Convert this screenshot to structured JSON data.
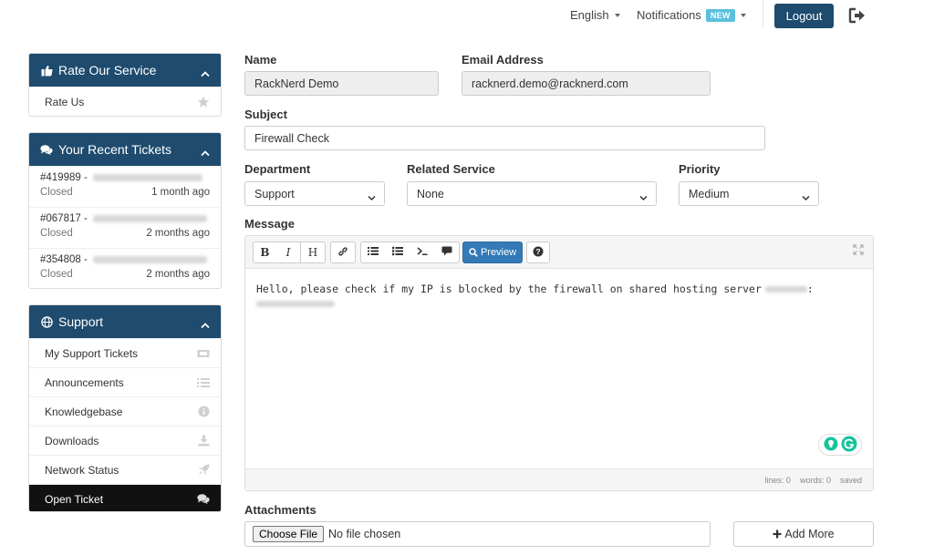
{
  "topbar": {
    "language": "English",
    "notifications": "Notifications",
    "new_badge": "NEW",
    "logout": "Logout"
  },
  "sidebar": {
    "rate": {
      "title": "Rate Our Service",
      "items": [
        {
          "label": "Rate Us",
          "icon": "star-icon"
        }
      ]
    },
    "tickets": {
      "title": "Your Recent Tickets",
      "items": [
        {
          "id": "#419989 - ",
          "status": "Closed",
          "time": "1 month ago"
        },
        {
          "id": "#067817 - ",
          "status": "Closed",
          "time": "2 months ago"
        },
        {
          "id": "#354808 - ",
          "status": "Closed",
          "time": "2 months ago"
        }
      ]
    },
    "support": {
      "title": "Support",
      "items": [
        {
          "label": "My Support Tickets",
          "icon": "ticket-icon"
        },
        {
          "label": "Announcements",
          "icon": "list-icon"
        },
        {
          "label": "Knowledgebase",
          "icon": "info-icon"
        },
        {
          "label": "Downloads",
          "icon": "download-icon"
        },
        {
          "label": "Network Status",
          "icon": "rocket-icon"
        },
        {
          "label": "Open Ticket",
          "icon": "comments-icon",
          "active": true
        }
      ]
    }
  },
  "form": {
    "name_label": "Name",
    "name_value": "RackNerd Demo",
    "email_label": "Email Address",
    "email_value": "racknerd.demo@racknerd.com",
    "subject_label": "Subject",
    "subject_value": "Firewall Check",
    "department_label": "Department",
    "department_value": "Support",
    "service_label": "Related Service",
    "service_value": "None",
    "priority_label": "Priority",
    "priority_value": "Medium",
    "message_label": "Message",
    "message_text": "Hello, please check if my IP is blocked by the firewall on shared hosting server",
    "message_colon": ":",
    "toolbar": {
      "bold": "B",
      "italic": "I",
      "heading": "H",
      "preview": "Preview",
      "help": "?"
    },
    "status": {
      "lines": "lines: 0",
      "words": "words: 0",
      "saved": "saved"
    },
    "attachments_label": "Attachments",
    "choose_file": "Choose File",
    "no_file": "No file chosen",
    "add_more": "Add More"
  },
  "colors": {
    "brand": "#1e4b6e",
    "primary": "#337ab7",
    "badge": "#5bc0de",
    "grammarly": "#15c39a"
  }
}
